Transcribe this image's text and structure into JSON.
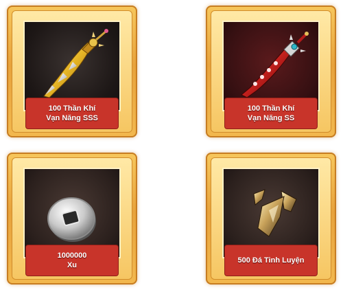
{
  "rewards": [
    {
      "line1": "100 Thần Khí",
      "line2": "Vạn Năng SSS",
      "icon": "golden-sword-icon"
    },
    {
      "line1": "100 Thần Khí",
      "line2": "Vạn Năng SS",
      "icon": "red-sword-icon"
    },
    {
      "line1": "1000000",
      "line2": "Xu",
      "icon": "silver-coin-icon"
    },
    {
      "line1": "500 Đá Tinh Luyện",
      "line2": "",
      "icon": "refining-stone-icon"
    }
  ],
  "colors": {
    "frame_gold": "#e7a23b",
    "label_red": "#c8342a",
    "text": "#ffffff"
  }
}
